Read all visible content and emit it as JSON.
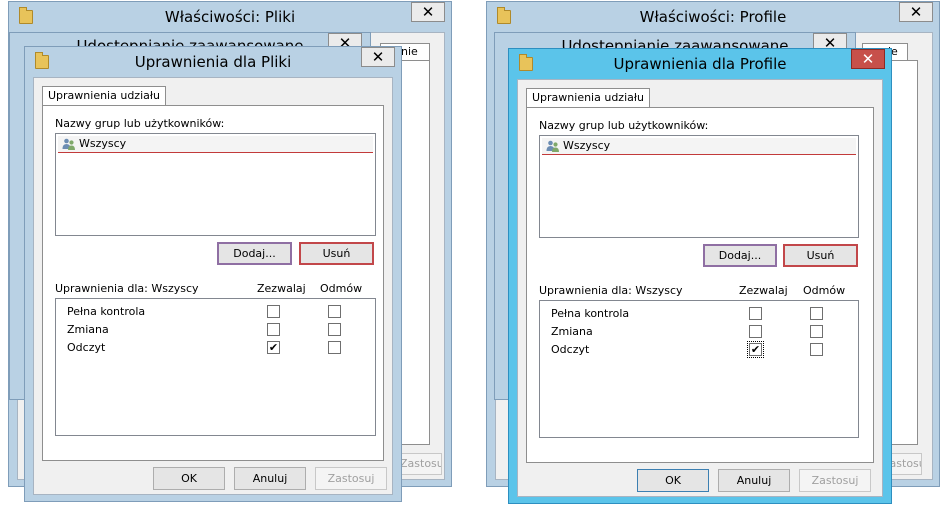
{
  "left": {
    "back_window": {
      "title": "Właściwości: Pliki",
      "close": "✕",
      "tab_fragment": "nie",
      "apply_fragment": "Zastosuj"
    },
    "mid_window": {
      "title": "Udostępnianie zaawansowane",
      "close": "✕"
    },
    "dialog": {
      "title": "Uprawnienia dla Pliki",
      "close": "✕",
      "tab": "Uprawnienia udziału",
      "groups_label": "Nazwy grup lub użytkowników:",
      "groups": [
        {
          "name": "Wszyscy",
          "icon": "users-icon"
        }
      ],
      "add_button": "Dodaj...",
      "remove_button": "Usuń",
      "permissions_for": "Uprawnienia dla: Wszyscy",
      "allow_header": "Zezwalaj",
      "deny_header": "Odmów",
      "permissions": [
        {
          "name": "Pełna kontrola",
          "allow": false,
          "deny": false
        },
        {
          "name": "Zmiana",
          "allow": false,
          "deny": false
        },
        {
          "name": "Odczyt",
          "allow": true,
          "deny": false
        }
      ],
      "ok": "OK",
      "cancel": "Anuluj",
      "apply": "Zastosuj"
    }
  },
  "right": {
    "back_window": {
      "title": "Właściwości: Profile",
      "close": "✕",
      "tab_fragment": "nie",
      "apply_fragment": "Zastosuj"
    },
    "mid_window": {
      "title": "Udostępnianie zaawansowane",
      "close": "✕"
    },
    "dialog": {
      "title": "Uprawnienia dla Profile",
      "close": "✕",
      "tab": "Uprawnienia udziału",
      "groups_label": "Nazwy grup lub użytkowników:",
      "groups": [
        {
          "name": "Wszyscy",
          "icon": "users-icon"
        }
      ],
      "add_button": "Dodaj...",
      "remove_button": "Usuń",
      "permissions_for": "Uprawnienia dla: Wszyscy",
      "allow_header": "Zezwalaj",
      "deny_header": "Odmów",
      "permissions": [
        {
          "name": "Pełna kontrola",
          "allow": false,
          "deny": false
        },
        {
          "name": "Zmiana",
          "allow": false,
          "deny": false
        },
        {
          "name": "Odczyt",
          "allow": true,
          "deny": false
        }
      ],
      "ok": "OK",
      "cancel": "Anuluj",
      "apply": "Zastosuj"
    }
  },
  "colors": {
    "inactive_frame": "#b9d1e4",
    "active_frame": "#5bc4ea",
    "close_active": "#c7504a",
    "selection_line": "#c23a3a"
  }
}
